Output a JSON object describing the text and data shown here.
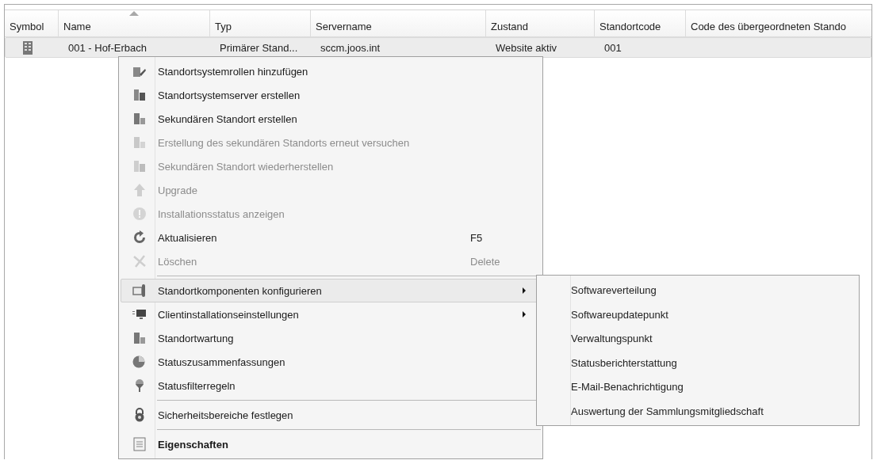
{
  "table": {
    "columns": [
      {
        "label": "Symbol",
        "sorted": false
      },
      {
        "label": "Name",
        "sorted": true
      },
      {
        "label": "Typ",
        "sorted": false
      },
      {
        "label": "Servername",
        "sorted": false
      },
      {
        "label": "Zustand",
        "sorted": false
      },
      {
        "label": "Standortcode",
        "sorted": false
      },
      {
        "label": "Code des übergeordneten Stando",
        "sorted": false
      }
    ],
    "rows": [
      {
        "selected": true,
        "cells": [
          "",
          "001 - Hof-Erbach",
          "Primärer Stand...",
          "sccm.joos.int",
          "Website aktiv",
          "001"
        ]
      }
    ]
  },
  "context_menu": {
    "items": [
      {
        "kind": "item",
        "label": "Standortsystemrollen hinzufügen",
        "disabled": false,
        "selected": false
      },
      {
        "kind": "item",
        "label": "Standortsystemserver erstellen",
        "disabled": false,
        "selected": false
      },
      {
        "kind": "item",
        "label": "Sekundären Standort erstellen",
        "disabled": false,
        "selected": false
      },
      {
        "kind": "item",
        "label": "Erstellung des sekundären Standorts erneut versuchen",
        "disabled": true,
        "selected": false
      },
      {
        "kind": "item",
        "label": "Sekundären Standort wiederherstellen",
        "disabled": true,
        "selected": false
      },
      {
        "kind": "item",
        "label": "Upgrade",
        "disabled": true,
        "selected": false
      },
      {
        "kind": "item",
        "label": "Installationsstatus anzeigen",
        "disabled": true,
        "selected": false
      },
      {
        "kind": "item",
        "label": "Aktualisieren",
        "shortcut": "F5",
        "disabled": false,
        "selected": false
      },
      {
        "kind": "item",
        "label": "Löschen",
        "shortcut": "Delete",
        "disabled": true,
        "selected": false
      },
      {
        "kind": "separator"
      },
      {
        "kind": "item",
        "label": "Standortkomponenten konfigurieren",
        "disabled": false,
        "selected": true,
        "has_submenu": true
      },
      {
        "kind": "item",
        "label": "Clientinstallationseinstellungen",
        "disabled": false,
        "selected": false,
        "has_submenu": true
      },
      {
        "kind": "item",
        "label": "Standortwartung",
        "disabled": false,
        "selected": false
      },
      {
        "kind": "item",
        "label": "Statuszusammenfassungen",
        "disabled": false,
        "selected": false
      },
      {
        "kind": "item",
        "label": "Statusfilterregeln",
        "disabled": false,
        "selected": false
      },
      {
        "kind": "separator"
      },
      {
        "kind": "item",
        "label": "Sicherheitsbereiche festlegen",
        "disabled": false,
        "selected": false
      },
      {
        "kind": "separator"
      },
      {
        "kind": "item",
        "label": "Eigenschaften",
        "disabled": false,
        "selected": false,
        "bold": true
      }
    ]
  },
  "submenu": {
    "items": [
      "Softwareverteilung",
      "Softwareupdatepunkt",
      "Verwaltungspunkt",
      "Statusberichterstattung",
      "E-Mail-Benachrichtigung",
      "Auswertung der Sammlungsmitgliedschaft"
    ]
  }
}
